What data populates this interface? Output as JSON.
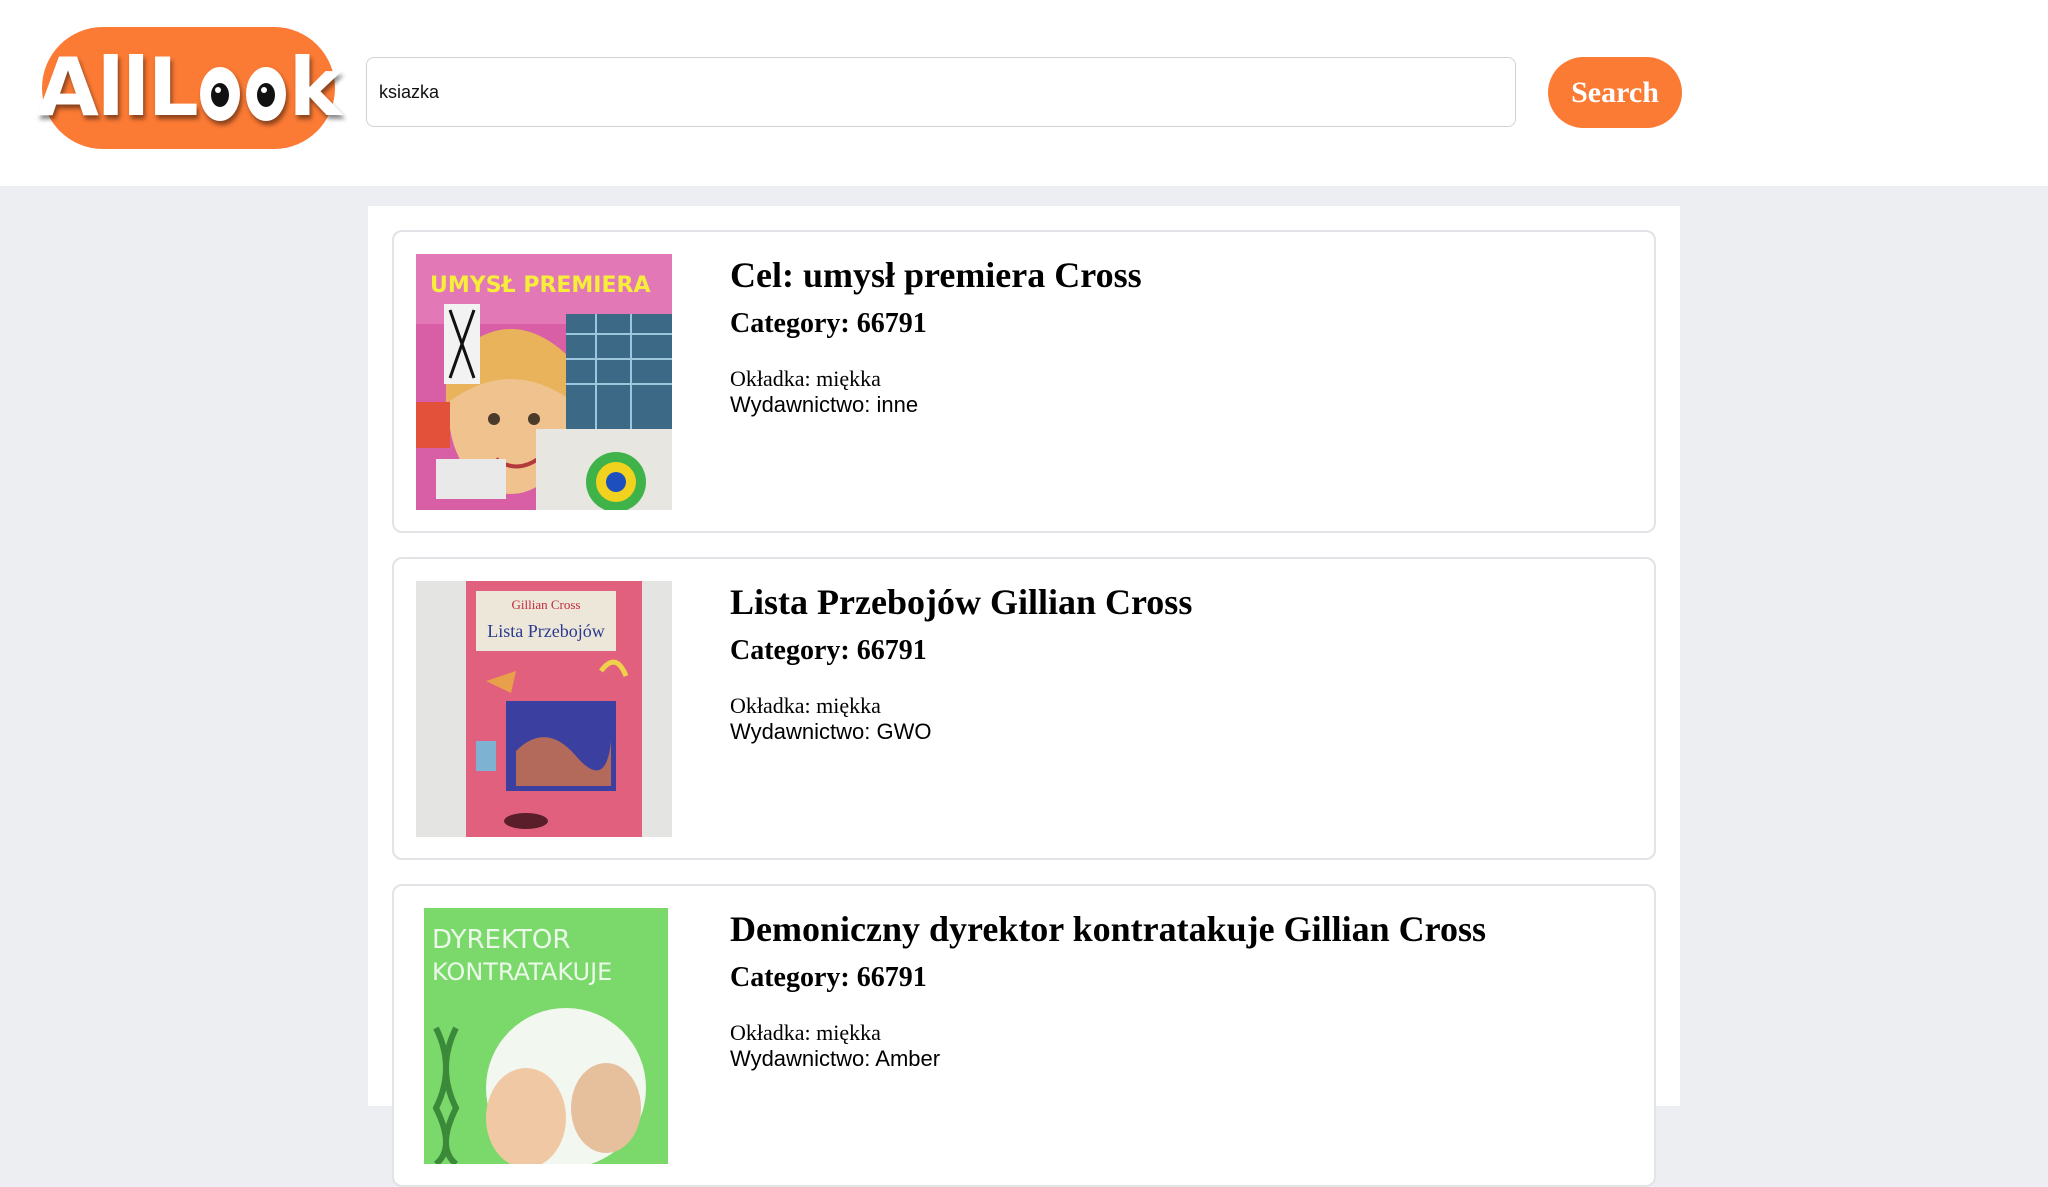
{
  "header": {
    "logo": {
      "text_left": "AllL",
      "text_right": "k"
    },
    "search": {
      "value": "ksiazka"
    },
    "search_button_label": "Search"
  },
  "results": [
    {
      "title": "Cel: umysł premiera Cross",
      "category": "Category: 66791",
      "cover_type": "Okładka: miękka",
      "publisher": "Wydawnictwo: inne",
      "cover_image_text": "UMYSŁ PREMIERA"
    },
    {
      "title": "Lista Przebojów Gillian Cross",
      "category": "Category: 66791",
      "cover_type": "Okładka: miękka",
      "publisher": "Wydawnictwo: GWO",
      "cover_image_text": [
        "Gillian Cross",
        "Lista Przebojów"
      ]
    },
    {
      "title": "Demoniczny dyrektor kontratakuje Gillian Cross",
      "category": "Category: 66791",
      "cover_type": "Okładka: miękka",
      "publisher": "Wydawnictwo: Amber",
      "cover_image_text": [
        "DYREKTOR",
        "KONTRATAKUJE"
      ]
    }
  ],
  "colors": {
    "accent": "#fb7a34",
    "page_background": "#eceef1",
    "card_border": "#e1e3e6"
  }
}
